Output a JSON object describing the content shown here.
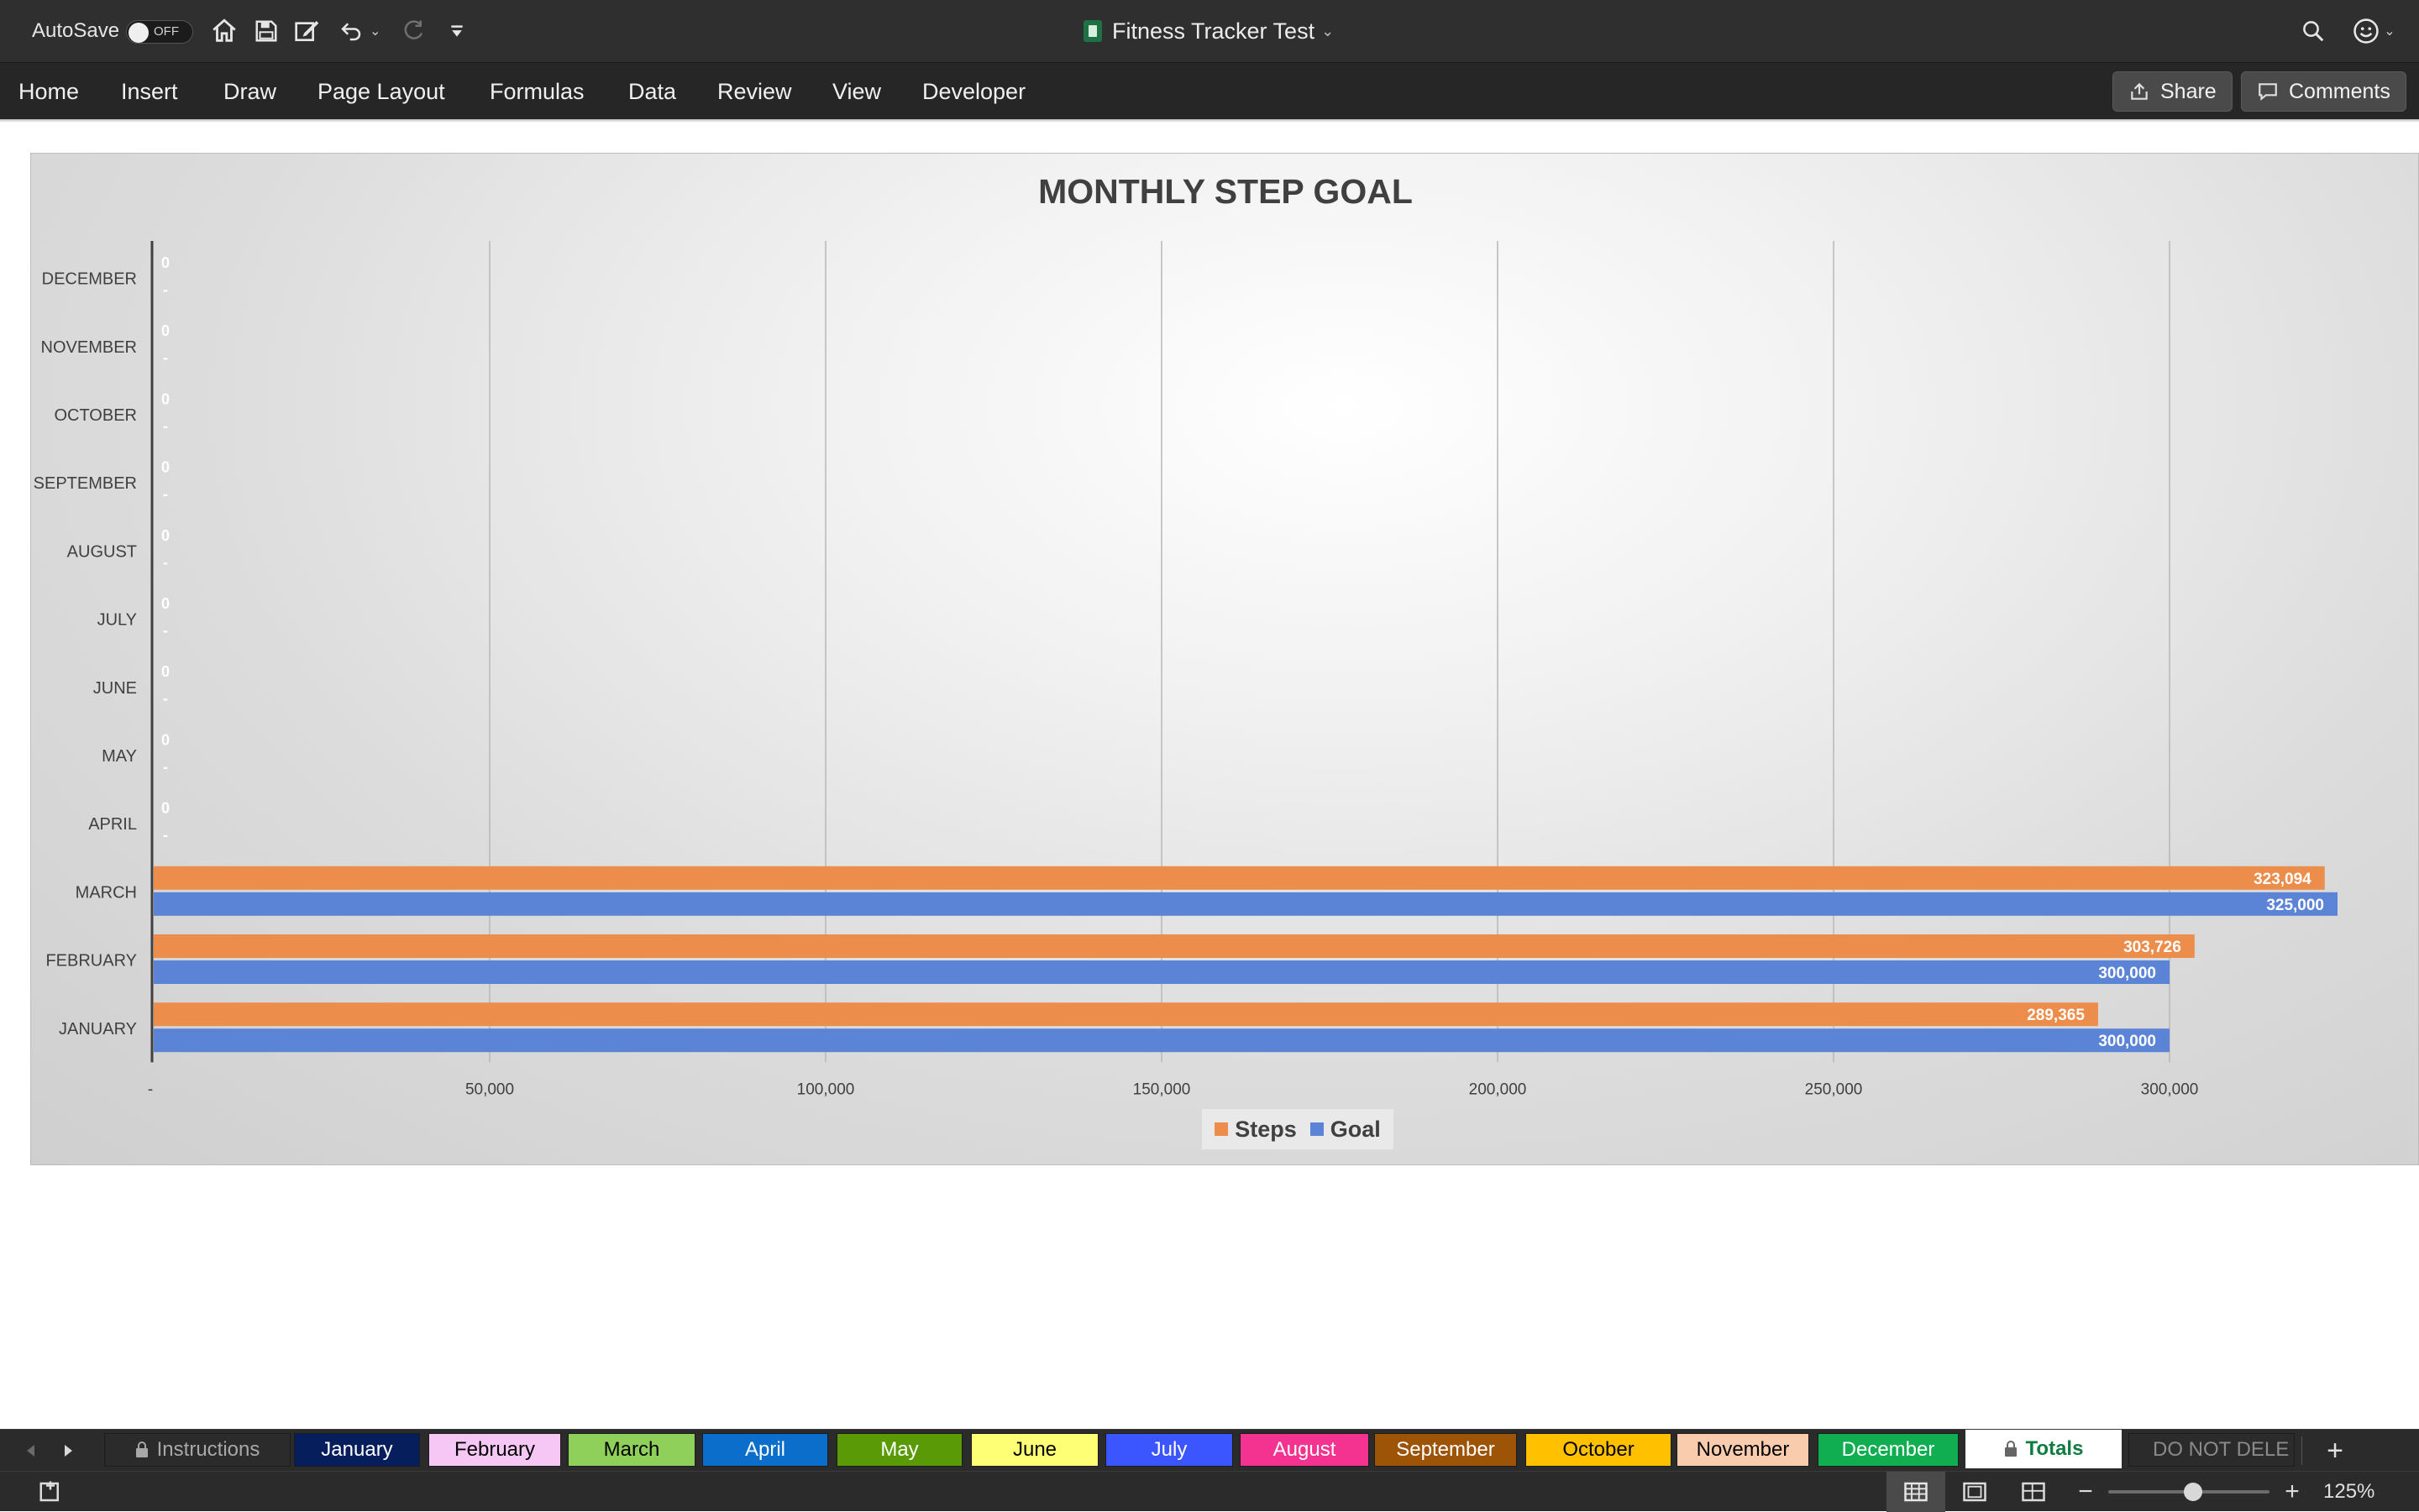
{
  "titlebar": {
    "autosave_label": "AutoSave",
    "autosave_state": "OFF",
    "document_title": "Fitness Tracker Test",
    "icons": [
      "home-icon",
      "save-icon",
      "edit-icon",
      "undo-icon",
      "redo-icon",
      "customize-icon",
      "search-icon",
      "smiley-icon"
    ]
  },
  "ribbon": {
    "tabs": [
      "Home",
      "Insert",
      "Draw",
      "Page Layout",
      "Formulas",
      "Data",
      "Review",
      "View",
      "Developer"
    ],
    "share_label": "Share",
    "comments_label": "Comments"
  },
  "chart_data": {
    "type": "bar",
    "orientation": "horizontal",
    "title": "MONTHLY STEP GOAL",
    "categories": [
      "JANUARY",
      "FEBRUARY",
      "MARCH",
      "APRIL",
      "MAY",
      "JUNE",
      "JULY",
      "AUGUST",
      "SEPTEMBER",
      "OCTOBER",
      "NOVEMBER",
      "DECEMBER"
    ],
    "series": [
      {
        "name": "Steps",
        "color": "#ed8d4c",
        "values": [
          289365,
          303726,
          323094,
          0,
          0,
          0,
          0,
          0,
          0,
          0,
          0,
          0
        ],
        "labels": [
          "289,365",
          "303,726",
          "323,094",
          "0",
          "0",
          "0",
          "0",
          "0",
          "0",
          "0",
          "0",
          "0"
        ]
      },
      {
        "name": "Goal",
        "color": "#5b84d6",
        "values": [
          300000,
          300000,
          325000,
          0,
          0,
          0,
          0,
          0,
          0,
          0,
          0,
          0
        ],
        "labels": [
          "300,000",
          "300,000",
          "325,000",
          "-",
          "-",
          "-",
          "-",
          "-",
          "-",
          "-",
          "-",
          "-"
        ]
      }
    ],
    "xticks": [
      0,
      50000,
      100000,
      150000,
      200000,
      250000,
      300000
    ],
    "xtick_labels": [
      "-",
      "50,000",
      "100,000",
      "150,000",
      "200,000",
      "250,000",
      "300,000"
    ],
    "xlim": [
      0,
      300000
    ],
    "grid": true,
    "legend": "bottom"
  },
  "sheet_tabs": [
    {
      "label": "Instructions",
      "bg": "#2b2b2b",
      "fg": "#a8a8a8",
      "locked": true
    },
    {
      "label": "January",
      "bg": "#061f5c",
      "fg": "#ffffff"
    },
    {
      "label": "February",
      "bg": "#f6c6f4",
      "fg": "#000000"
    },
    {
      "label": "March",
      "bg": "#8fd05a",
      "fg": "#000000"
    },
    {
      "label": "April",
      "bg": "#0c6ecb",
      "fg": "#ffffff"
    },
    {
      "label": "May",
      "bg": "#5a9a06",
      "fg": "#ffffff"
    },
    {
      "label": "June",
      "bg": "#ffff76",
      "fg": "#000000"
    },
    {
      "label": "July",
      "bg": "#3b55ff",
      "fg": "#ffffff"
    },
    {
      "label": "August",
      "bg": "#f3338f",
      "fg": "#ffffff"
    },
    {
      "label": "September",
      "bg": "#9e5406",
      "fg": "#ffffff"
    },
    {
      "label": "October",
      "bg": "#ffc000",
      "fg": "#000000"
    },
    {
      "label": "November",
      "bg": "#f8ccac",
      "fg": "#000000"
    },
    {
      "label": "December",
      "bg": "#10ad51",
      "fg": "#ffffff"
    },
    {
      "label": "Totals",
      "bg": "#ffffff",
      "fg": "#107c41",
      "locked": true
    },
    {
      "label": "DO NOT DELE",
      "bg": "#2b2b2b",
      "fg": "#8a8a8a"
    }
  ],
  "statusbar": {
    "zoom": "125%",
    "zoom_level": 125
  }
}
